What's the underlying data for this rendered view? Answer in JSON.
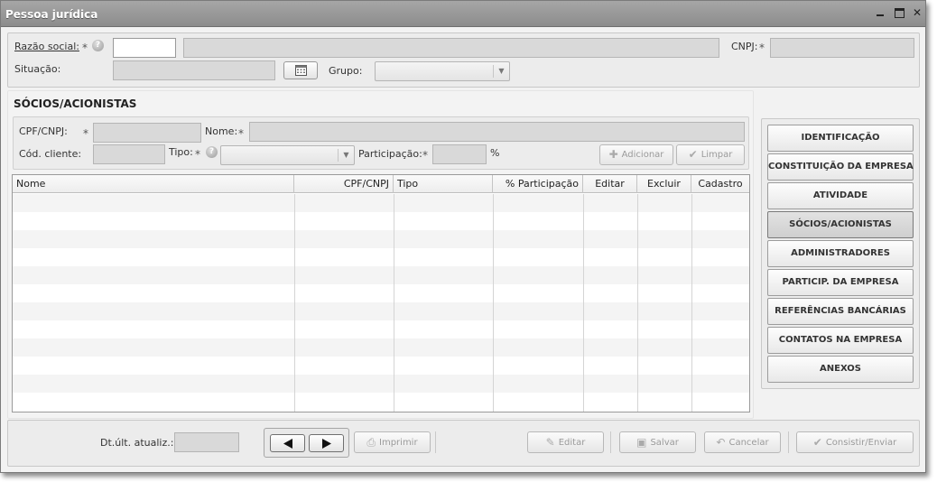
{
  "window": {
    "title": "Pessoa jurídica"
  },
  "header_form": {
    "razao_social_label": "Razão social:",
    "cnpj_label": "CNPJ:",
    "situacao_label": "Situação:",
    "grupo_label": "Grupo:",
    "required_mark": "*",
    "help_glyph": "?"
  },
  "socios": {
    "section_title": "SÓCIOS/ACIONISTAS",
    "cpf_cnpj_label": "CPF/CNPJ:",
    "nome_label": "Nome:",
    "cod_cliente_label": "Cód. cliente:",
    "tipo_label": "Tipo:",
    "participacao_label": "Participação:",
    "percent_sign": "%",
    "adicionar_label": "Adicionar",
    "limpar_label": "Limpar"
  },
  "grid": {
    "columns": [
      "Nome",
      "CPF/CNPJ",
      "Tipo",
      "% Participação",
      "Editar",
      "Excluir",
      "Cadastro"
    ],
    "rows": []
  },
  "nav": {
    "items": [
      "IDENTIFICAÇÃO",
      "CONSTITUIÇÃO DA EMPRESA",
      "ATIVIDADE",
      "SÓCIOS/ACIONISTAS",
      "ADMINISTRADORES",
      "PARTICIP. DA EMPRESA",
      "REFERÊNCIAS BANCÁRIAS",
      "CONTATOS NA EMPRESA",
      "ANEXOS"
    ],
    "active": "SÓCIOS/ACIONISTAS"
  },
  "footer": {
    "dt_ult_atualiz_label": "Dt.últ. atualiz.:",
    "imprimir_label": "Imprimir",
    "editar_label": "Editar",
    "salvar_label": "Salvar",
    "cancelar_label": "Cancelar",
    "consistir_label": "Consistir/Enviar"
  },
  "icons": {
    "minimize": "minimize-icon",
    "maximize": "maximize-icon",
    "close": "close-icon",
    "calendar": "calendar-icon",
    "plus": "plus-icon",
    "eraser": "eraser-icon",
    "prev": "arrow-left-icon",
    "next": "arrow-right-icon",
    "printer": "printer-icon",
    "pencil": "pencil-icon",
    "floppy": "floppy-icon",
    "undo": "undo-icon",
    "check": "check-icon"
  }
}
